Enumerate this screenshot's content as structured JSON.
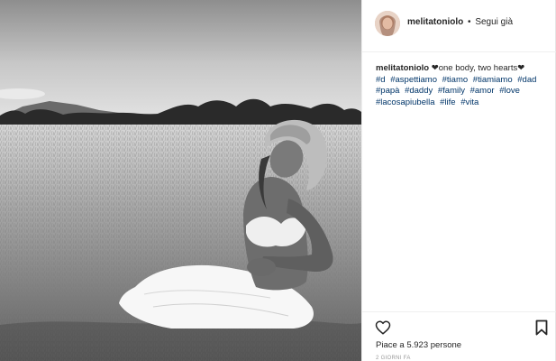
{
  "post": {
    "username": "melitatoniolo",
    "separator": "•",
    "follow_label": "Segui già",
    "caption_username": "melitatoniolo",
    "caption_text": "❤one body, two hearts❤",
    "hashtags": [
      "#d",
      "#aspettiamo",
      "#tiamo",
      "#tiamiamo",
      "#dad",
      "#papà",
      "#daddy",
      "#family",
      "#amor",
      "#love",
      "#lacosapiubella",
      "#life",
      "#vita"
    ],
    "likes_text": "Piace a 5.923 persone",
    "time_ago": "2 GIORNI FA"
  },
  "icons": {
    "like": "heart-outline-icon",
    "save": "bookmark-icon"
  },
  "colors": {
    "hashtag": "#003569",
    "text": "#262626",
    "muted": "#999999"
  }
}
